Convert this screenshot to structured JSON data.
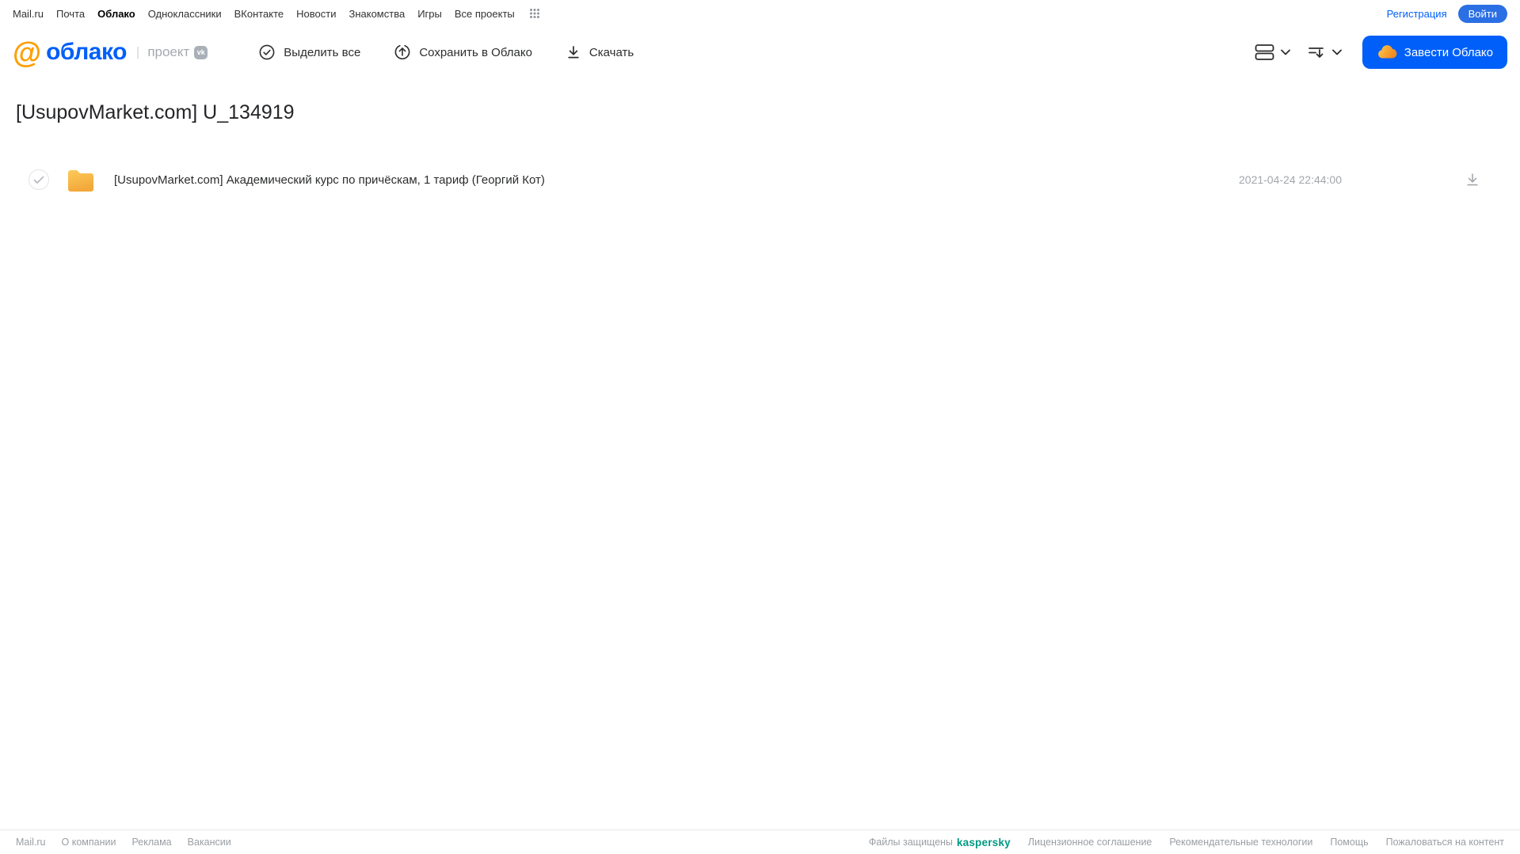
{
  "topnav": {
    "links": [
      {
        "label": "Mail.ru"
      },
      {
        "label": "Почта"
      },
      {
        "label": "Облако"
      },
      {
        "label": "Одноклассники"
      },
      {
        "label": "ВКонтакте"
      },
      {
        "label": "Новости"
      },
      {
        "label": "Знакомства"
      },
      {
        "label": "Игры"
      },
      {
        "label": "Все проекты"
      }
    ],
    "register_label": "Регистрация",
    "login_label": "Войти"
  },
  "header": {
    "logo_at": "@",
    "logo_text": "облако",
    "logo_sep": "|",
    "logo_suffix": "проект",
    "vk_badge": "vk",
    "toolbar": {
      "select_all": "Выделить все",
      "save_to_cloud": "Сохранить в Облако",
      "download": "Скачать"
    },
    "get_cloud_label": "Завести Облако"
  },
  "main": {
    "title": "[UsupovMarket.com] U_134919",
    "files": [
      {
        "name": "[UsupovMarket.com] Академический курс по причёскам, 1 тариф (Георгий Кот)",
        "date": "2021-04-24 22:44:00"
      }
    ]
  },
  "footer": {
    "left_links": [
      "Mail.ru",
      "О компании",
      "Реклама",
      "Вакансии"
    ],
    "protected_label": "Файлы защищены",
    "kaspersky_label": "kaspersky",
    "right_links": [
      "Лицензионное соглашение",
      "Рекомендательные технологии",
      "Помощь",
      "Пожаловаться на контент"
    ]
  },
  "colors": {
    "brand_blue": "#005ff9",
    "brand_orange": "#ff9e00",
    "folder_yellow": "#fbbc4d",
    "kaspersky_teal": "#009982"
  }
}
